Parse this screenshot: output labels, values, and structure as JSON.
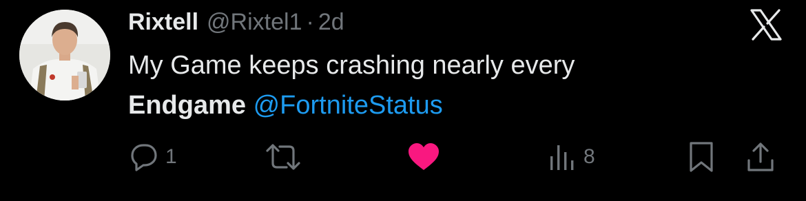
{
  "tweet": {
    "display_name": "Rixtell",
    "handle": "@Rixtel1",
    "separator": "·",
    "time": "2d",
    "text_line1": "My Game keeps crashing nearly every",
    "text_bold": "Endgame",
    "mention": "@FortniteStatus"
  },
  "actions": {
    "reply_count": "1",
    "views_count": "8",
    "liked": true
  },
  "icons": {
    "reply": "reply-icon",
    "retweet": "retweet-icon",
    "like": "heart-icon",
    "views": "views-icon",
    "bookmark": "bookmark-icon",
    "share": "share-icon",
    "logo": "x-logo-icon"
  },
  "colors": {
    "background": "#000000",
    "text": "#e7e9ea",
    "muted": "#71767b",
    "link": "#1d9bf0",
    "like": "#f91880"
  }
}
